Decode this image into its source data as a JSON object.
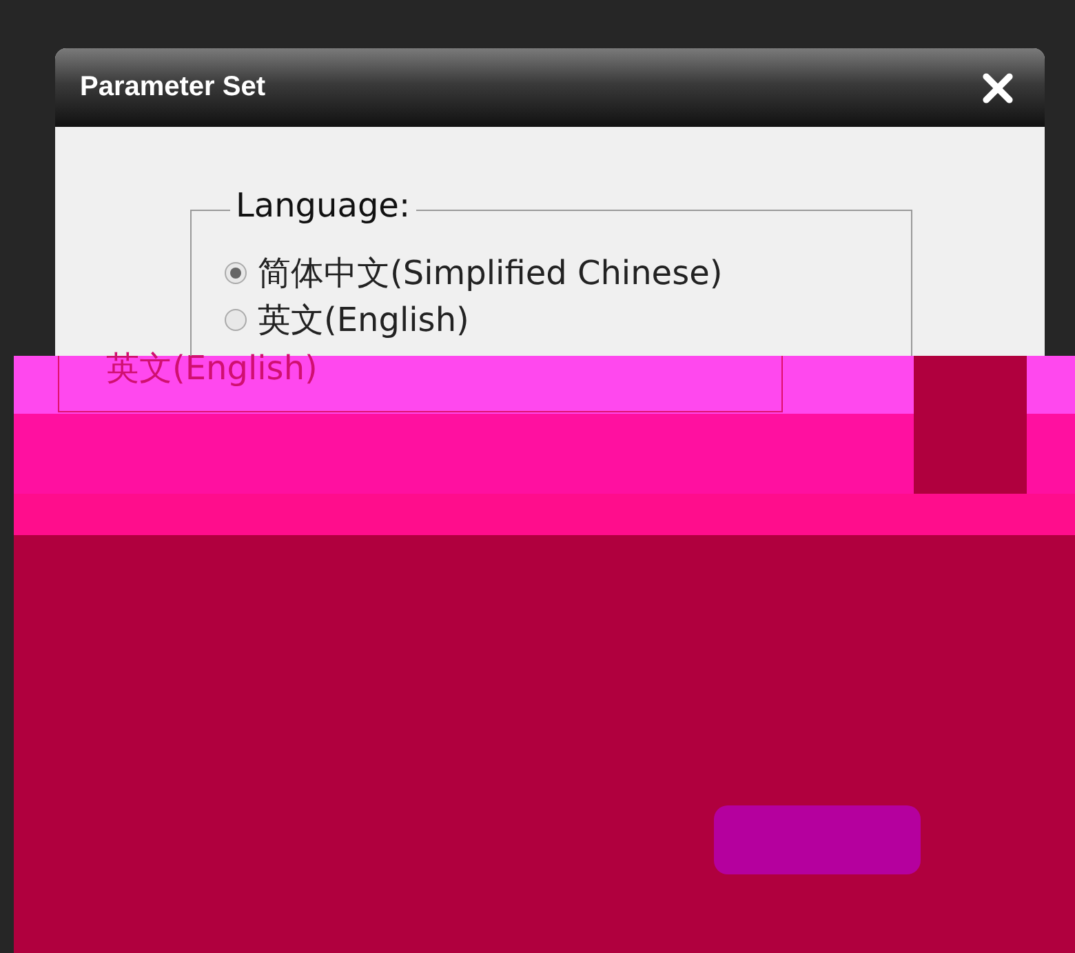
{
  "window": {
    "title": "Parameter Set"
  },
  "language": {
    "legend": "Language:",
    "options": [
      {
        "label": "简体中文(Simplified Chinese)",
        "selected": true
      },
      {
        "label": "英文(English)",
        "selected": false
      }
    ]
  },
  "corrupted_band": {
    "text": "英文(English)"
  }
}
